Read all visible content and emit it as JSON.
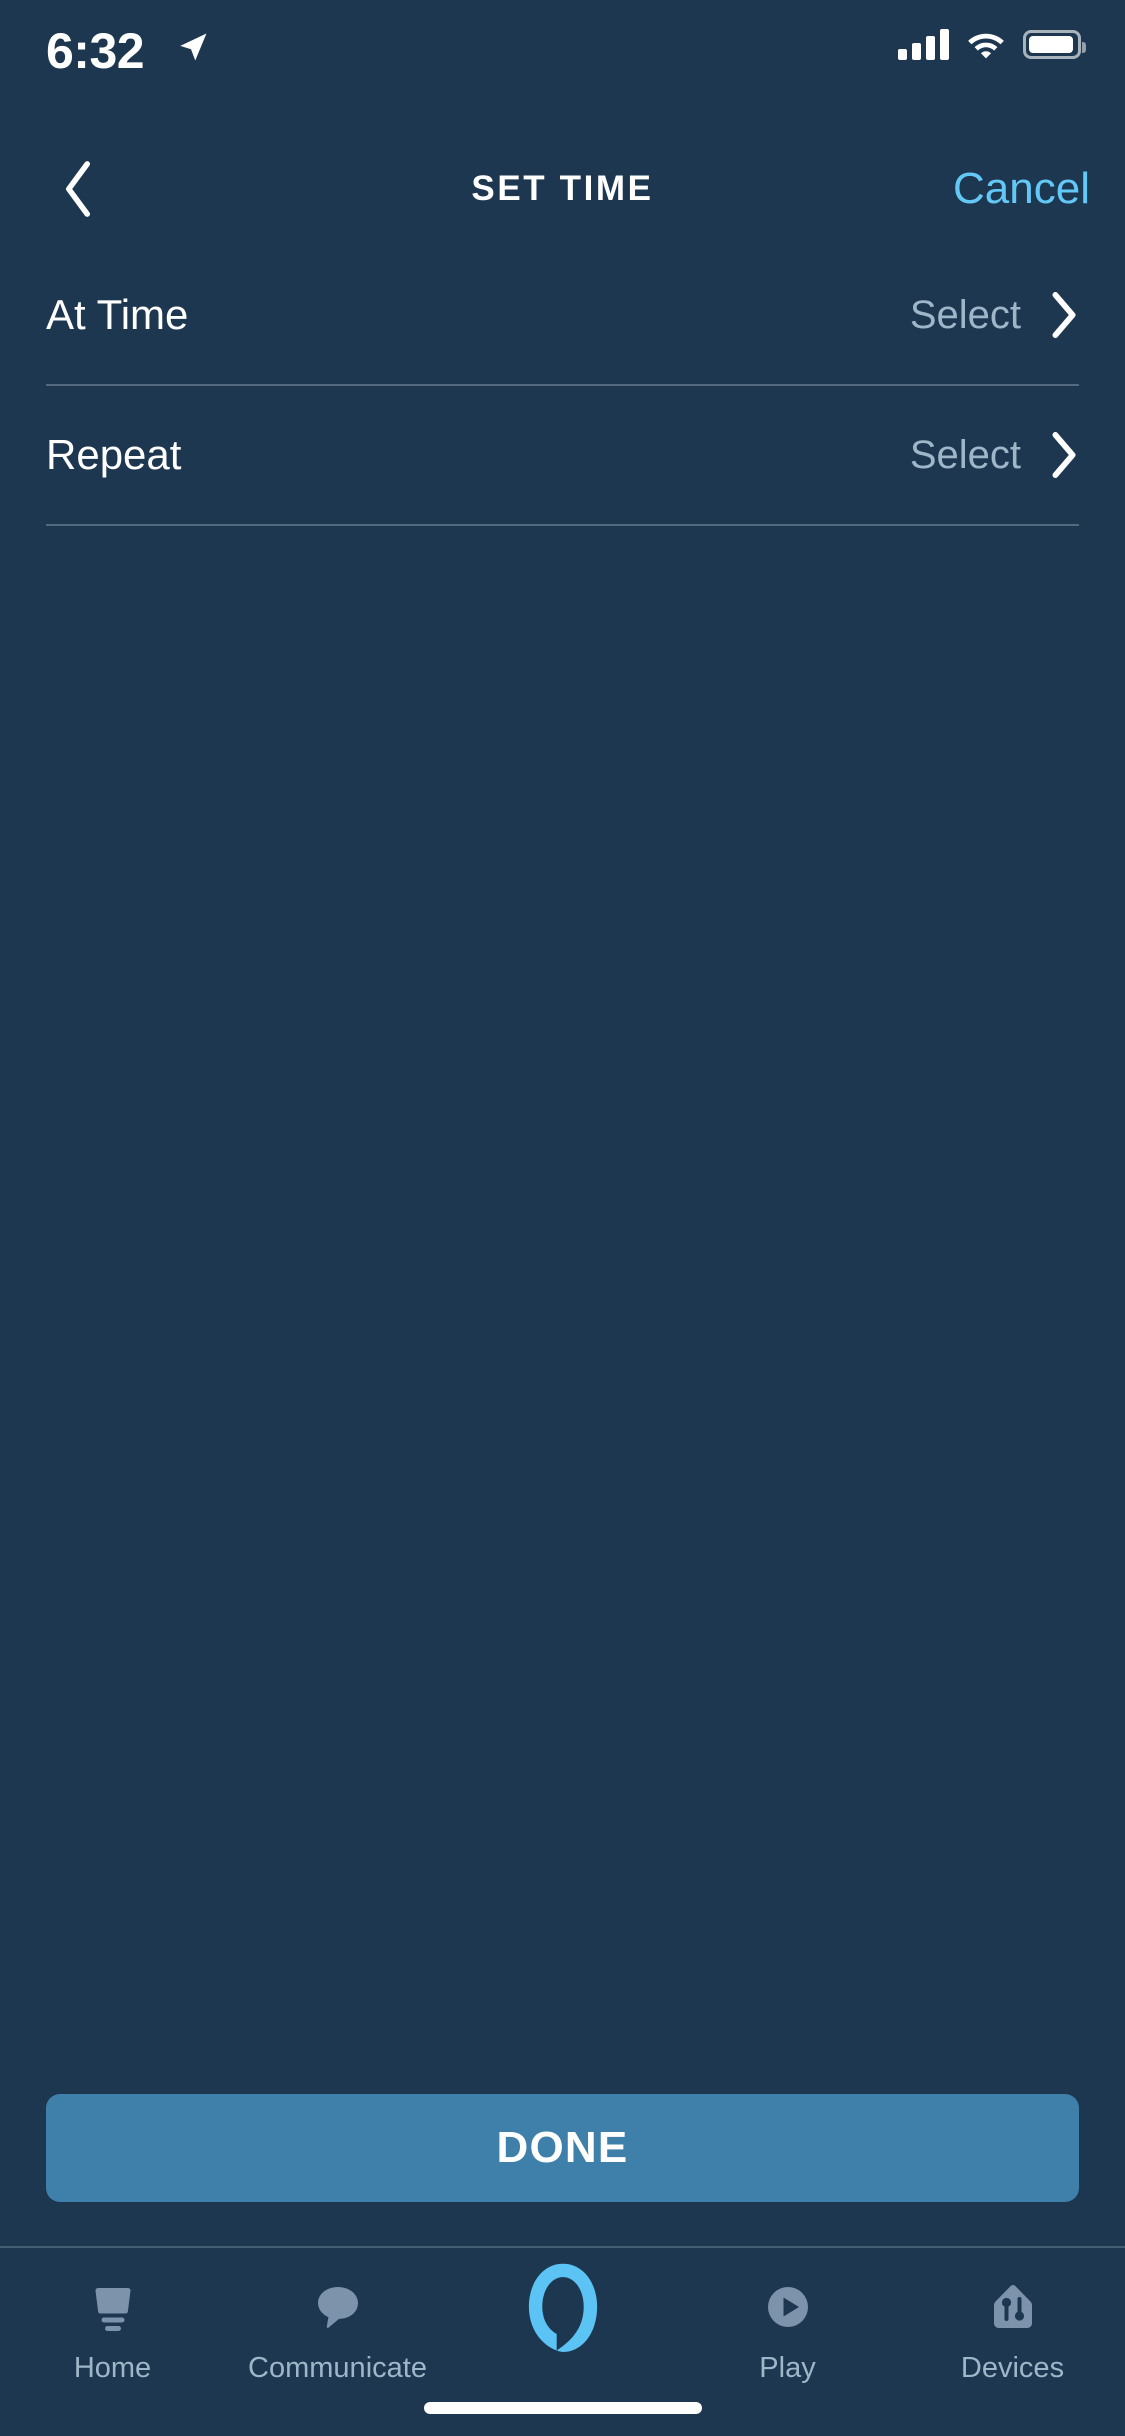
{
  "theme": {
    "background": "#1e3750",
    "accent_blue": "#63c8f5",
    "button_blue": "#3f80aa",
    "muted_text": "#9fb6c8",
    "alexa_ring": "#5cc4f5",
    "tab_icon": "#7d93ab"
  },
  "status_bar": {
    "time": "6:32",
    "location_icon": "location-arrow-icon",
    "cellular_icon": "cellular-signal-icon",
    "wifi_icon": "wifi-icon",
    "battery_icon": "battery-icon"
  },
  "nav_bar": {
    "back_icon": "chevron-left-icon",
    "title": "SET TIME",
    "cancel_label": "Cancel"
  },
  "list": {
    "rows": [
      {
        "label": "At Time",
        "value": "Select",
        "chevron": "chevron-right-icon"
      },
      {
        "label": "Repeat",
        "value": "Select",
        "chevron": "chevron-right-icon"
      }
    ]
  },
  "footer": {
    "done_label": "DONE"
  },
  "tab_bar": {
    "tabs": [
      {
        "label": "Home",
        "icon": "home-icon",
        "active": false
      },
      {
        "label": "Communicate",
        "icon": "speech-bubble-icon",
        "active": false
      },
      {
        "label": "",
        "icon": "alexa-ring-icon",
        "active": false
      },
      {
        "label": "Play",
        "icon": "play-circle-icon",
        "active": false
      },
      {
        "label": "Devices",
        "icon": "devices-house-icon",
        "active": false
      }
    ]
  }
}
